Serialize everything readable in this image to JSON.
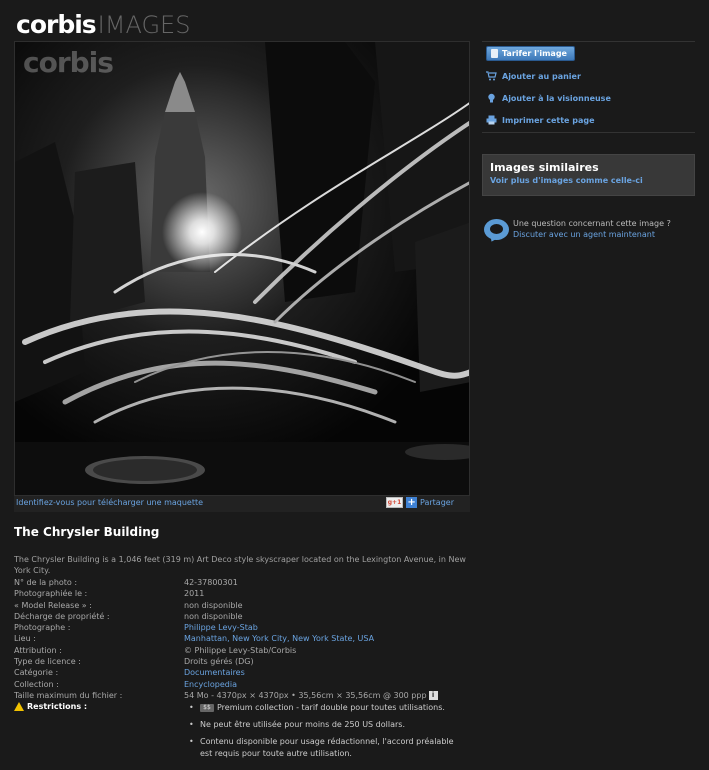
{
  "header": {
    "logo_brand": "corbis",
    "logo_suffix": "IMAGES"
  },
  "photo": {
    "watermark": "corbis",
    "alt": "The Chrysler Building"
  },
  "below_photo": {
    "login_link": "Identifiez-vous pour télécharger une maquette",
    "gplus_label": "g+1",
    "share_label": "Partager"
  },
  "title": "The Chrysler Building",
  "description": "The Chrysler Building is a 1,046 feet (319 m) Art Deco style skyscraper located on the Lexington Avenue, in New York City.",
  "meta": [
    {
      "label": "N° de la photo :",
      "value": "42-37800301",
      "link": false
    },
    {
      "label": "Photographiée le :",
      "value": "2011",
      "link": false
    },
    {
      "label": "« Model Release » :",
      "value": "non disponible",
      "link": false
    },
    {
      "label": "Décharge de propriété :",
      "value": "non disponible",
      "link": false
    },
    {
      "label": "Photographe :",
      "value": "Philippe Levy-Stab",
      "link": true
    },
    {
      "label": "Lieu :",
      "value": "Manhattan, New York City, New York State, USA",
      "link": true
    },
    {
      "label": "Attribution :",
      "value": "© Philippe Levy-Stab/Corbis",
      "link": false
    },
    {
      "label": "Type de licence :",
      "value": "Droits gérés (DG)",
      "link": false
    },
    {
      "label": "Catégorie :",
      "value": "Documentaires",
      "link": true
    },
    {
      "label": "Collection :",
      "value": "Encyclopedia",
      "link": true
    },
    {
      "label": "Taille maximum du fichier :",
      "value": "54  Mo - 4370px × 4370px • 35,56cm × 35,56cm @ 300 ppp",
      "link": false
    }
  ],
  "restrictions": {
    "label": "Restrictions :",
    "premium_badge": "$$",
    "items": [
      "Premium collection - tarif double pour toutes utilisations.",
      "Ne peut être utilisée pour moins de 250 US dollars.",
      "Contenu disponible pour usage rédactionnel, l'accord préalable est requis pour toute autre utilisation."
    ]
  },
  "actions": {
    "price_button": "Tarifer l'image",
    "add_cart": "Ajouter au panier",
    "add_lightbox": "Ajouter à la visionneuse",
    "print": "Imprimer cette page"
  },
  "similar": {
    "title": "Images similaires",
    "link": "Voir plus d'images comme celle-ci"
  },
  "chat": {
    "question": "Une question concernant cette image ?",
    "link": "Discuter avec un agent maintenant"
  },
  "colors": {
    "background": "#1a1a1a",
    "link": "#6aa3e0",
    "button": "#4a86c4"
  }
}
